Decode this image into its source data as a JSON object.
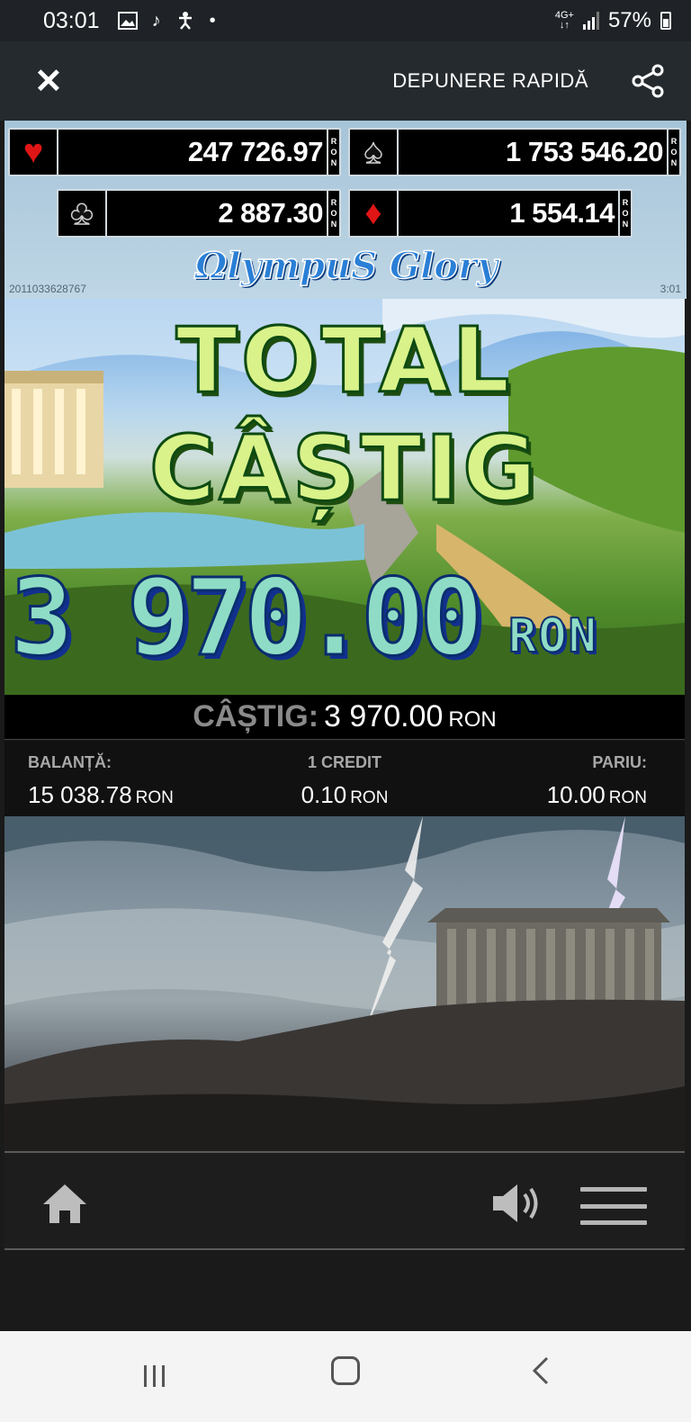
{
  "status_bar": {
    "time": "03:01",
    "left_icons": [
      "image-icon",
      "music-note-icon",
      "accessibility-icon",
      "dot-icon"
    ],
    "network": "4G+",
    "battery": "57%"
  },
  "app_header": {
    "deposit_label": "DEPUNERE RAPIDĂ"
  },
  "jackpots": {
    "currency": "RON",
    "hearts": "247 726.97",
    "spades": "1 753 546.20",
    "clubs": "2 887.30",
    "diamonds": "1 554.14"
  },
  "game": {
    "logo": "ΩlympuS Glory",
    "session_id": "2011033628767",
    "session_time": "3:01"
  },
  "win_banner": {
    "line1": "TOTAL",
    "line2": "CÂȘTIG",
    "amount": "3 970.00",
    "currency": "RON"
  },
  "win_line": {
    "label": "CÂȘTIG:",
    "value": "3 970.00",
    "currency": "RON"
  },
  "info": {
    "balance_label": "BALANȚĂ:",
    "balance_value": "15 038.78",
    "credit_label": "1 CREDIT",
    "credit_value": "0.10",
    "bet_label": "PARIU:",
    "bet_value": "10.00",
    "currency": "RON"
  },
  "controls": {
    "icons": [
      "home-icon",
      "speaker-icon",
      "menu-icon"
    ]
  },
  "colors": {
    "jackpot_panel": "#a6c4d8",
    "win_text": "#d9f28a",
    "amount_text": "#8fdcc6",
    "heart": "#e01515",
    "diamond": "#e01515"
  }
}
